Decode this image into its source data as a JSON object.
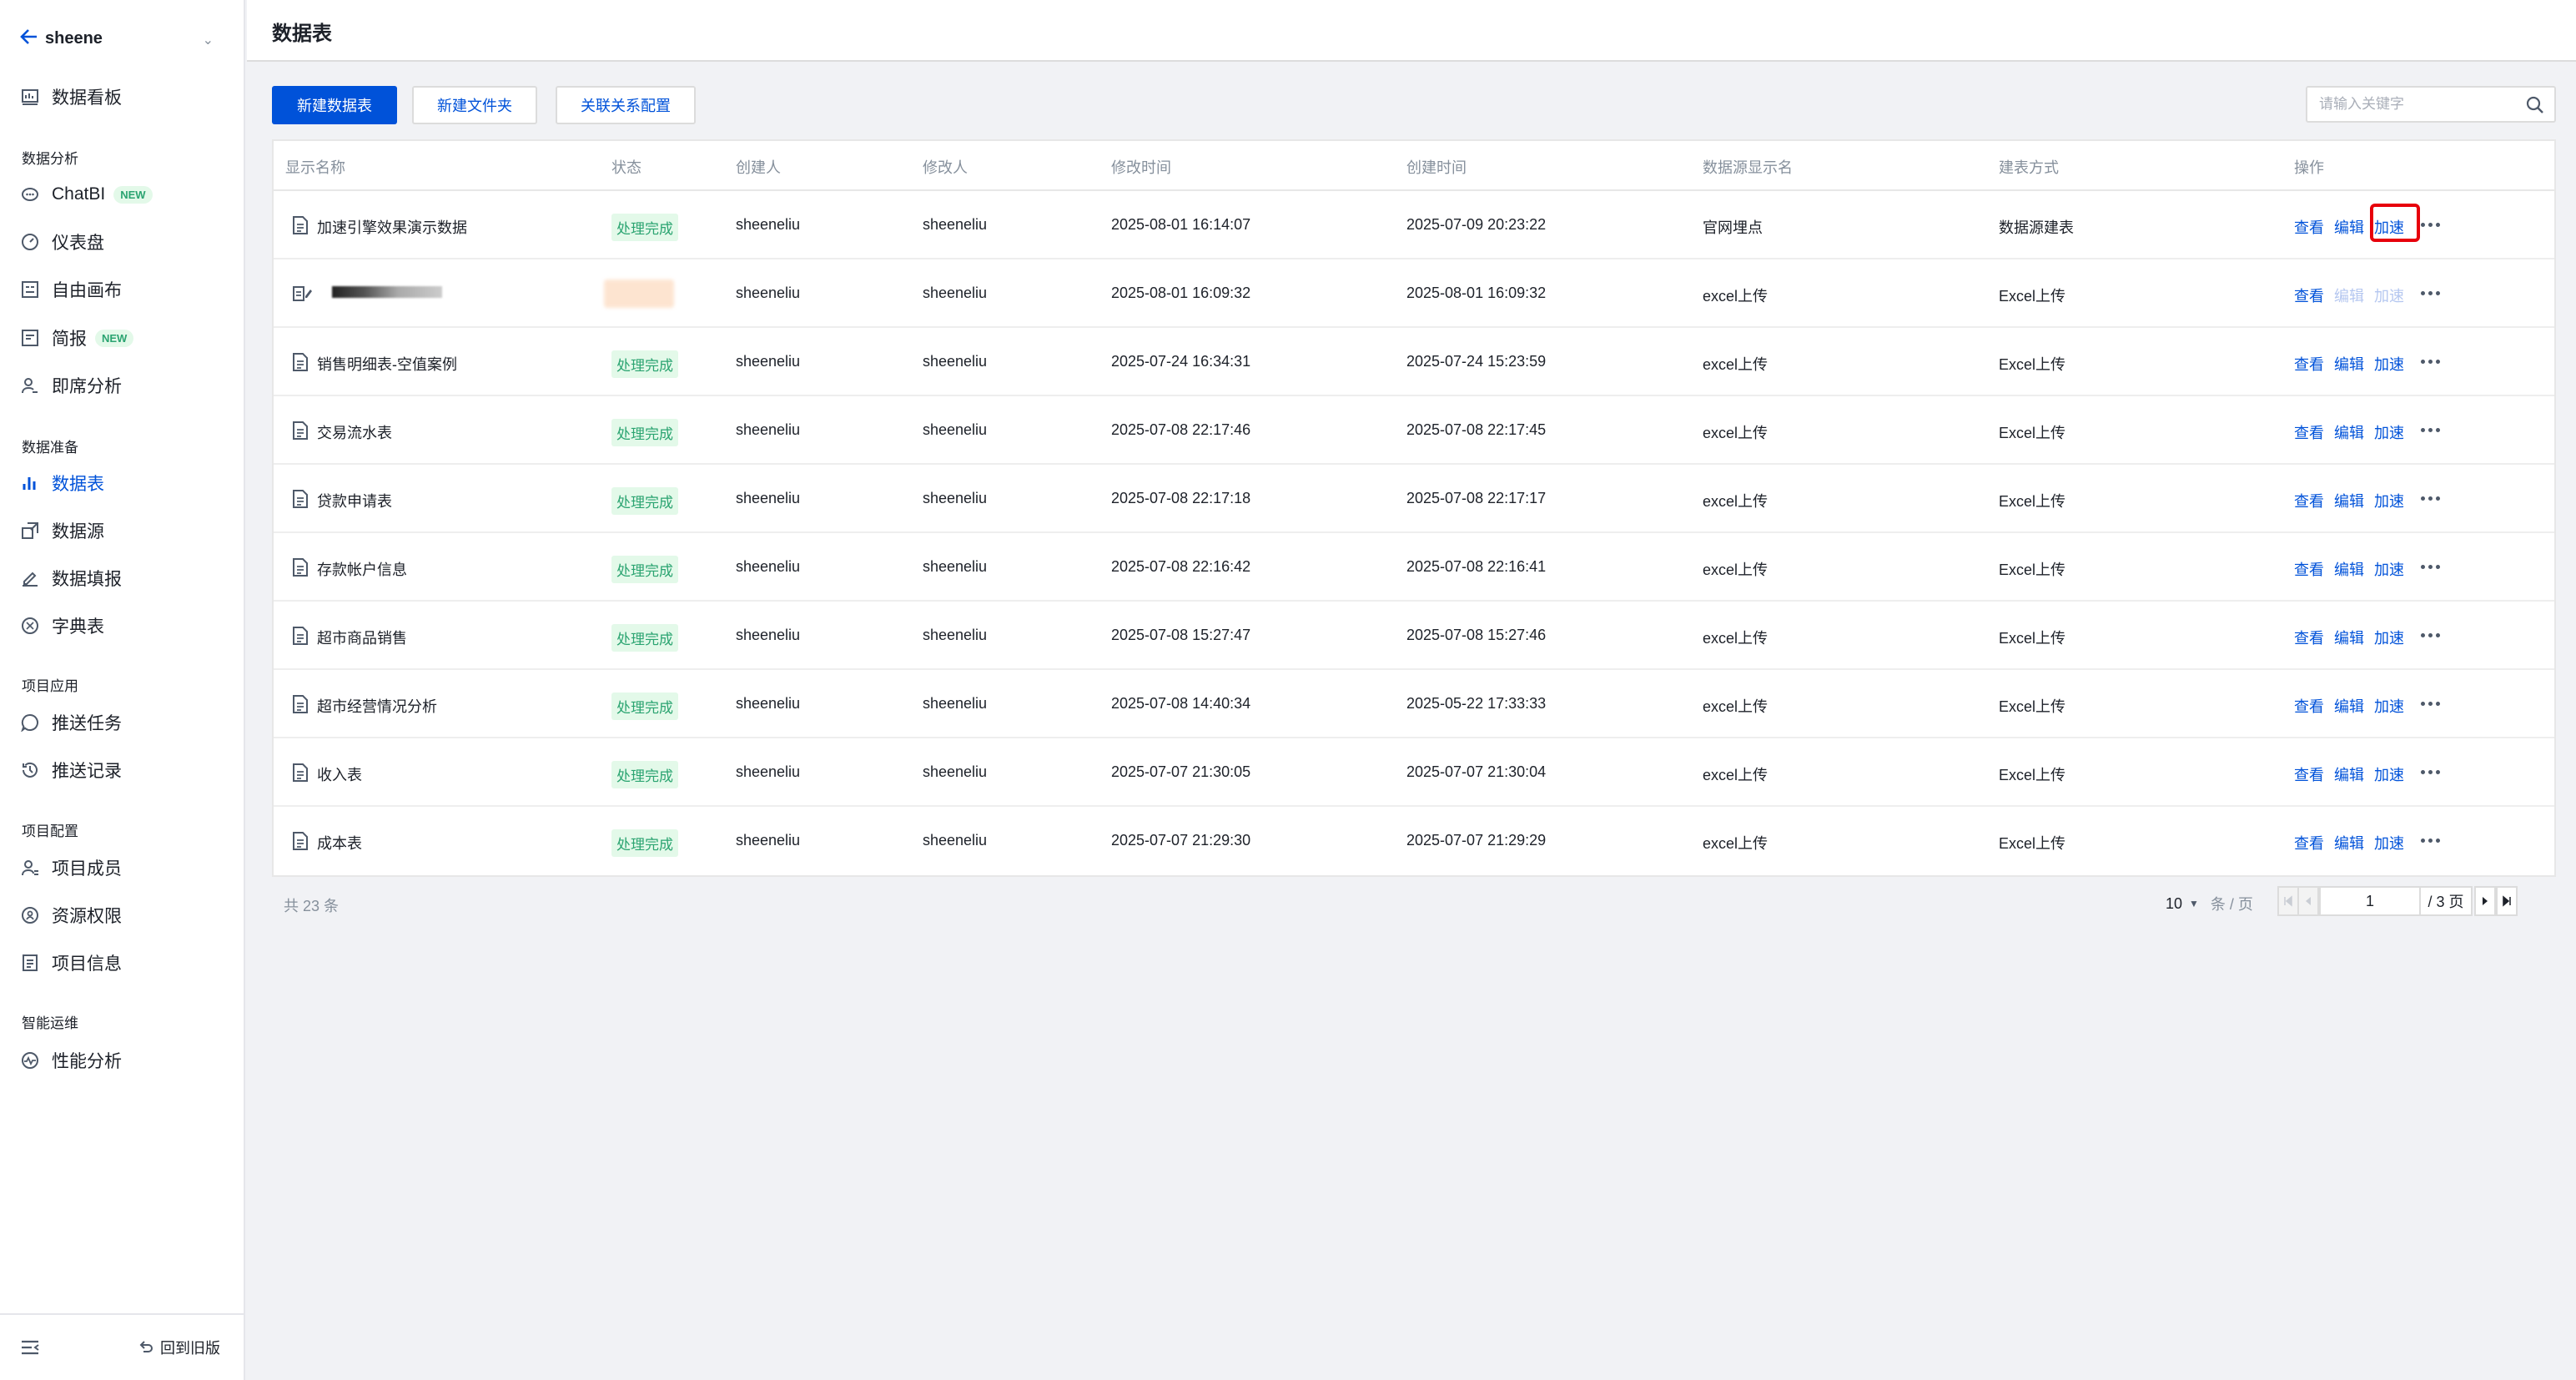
{
  "sidebar": {
    "project_name": "sheene",
    "groups": {
      "analysis": "数据分析",
      "prep": "数据准备",
      "apps": "项目应用",
      "config": "项目配置",
      "ops": "智能运维"
    },
    "items": {
      "dashboard": "数据看板",
      "chatbi": "ChatBI",
      "panel": "仪表盘",
      "canvas": "自由画布",
      "report": "简报",
      "adhoc": "即席分析",
      "datatable": "数据表",
      "datasource": "数据源",
      "datafill": "数据填报",
      "dictionary": "字典表",
      "push_task": "推送任务",
      "push_record": "推送记录",
      "members": "项目成员",
      "permissions": "资源权限",
      "project_info": "项目信息",
      "perf": "性能分析"
    },
    "badge_new": "NEW",
    "back_old": "回到旧版"
  },
  "header": {
    "title": "数据表"
  },
  "toolbar": {
    "new_table": "新建数据表",
    "new_folder": "新建文件夹",
    "relation_config": "关联关系配置",
    "search_placeholder": "请输入关键字"
  },
  "table": {
    "columns": [
      "显示名称",
      "状态",
      "创建人",
      "修改人",
      "修改时间",
      "创建时间",
      "数据源显示名",
      "建表方式",
      "操作"
    ],
    "actions": {
      "view": "查看",
      "edit": "编辑",
      "accel": "加速"
    },
    "rows": [
      {
        "name": "加速引擎效果演示数据",
        "status": "处理完成",
        "creator": "sheeneliu",
        "modifier": "sheeneliu",
        "modified": "2025-08-01 16:14:07",
        "created": "2025-07-09 20:23:22",
        "source": "官网埋点",
        "method": "数据源建表"
      },
      {
        "name": "",
        "status": "",
        "creator": "sheeneliu",
        "modifier": "sheeneliu",
        "modified": "2025-08-01 16:09:32",
        "created": "2025-08-01 16:09:32",
        "source": "excel上传",
        "method": "Excel上传"
      },
      {
        "name": "销售明细表-空值案例",
        "status": "处理完成",
        "creator": "sheeneliu",
        "modifier": "sheeneliu",
        "modified": "2025-07-24 16:34:31",
        "created": "2025-07-24 15:23:59",
        "source": "excel上传",
        "method": "Excel上传"
      },
      {
        "name": "交易流水表",
        "status": "处理完成",
        "creator": "sheeneliu",
        "modifier": "sheeneliu",
        "modified": "2025-07-08 22:17:46",
        "created": "2025-07-08 22:17:45",
        "source": "excel上传",
        "method": "Excel上传"
      },
      {
        "name": "贷款申请表",
        "status": "处理完成",
        "creator": "sheeneliu",
        "modifier": "sheeneliu",
        "modified": "2025-07-08 22:17:18",
        "created": "2025-07-08 22:17:17",
        "source": "excel上传",
        "method": "Excel上传"
      },
      {
        "name": "存款帐户信息",
        "status": "处理完成",
        "creator": "sheeneliu",
        "modifier": "sheeneliu",
        "modified": "2025-07-08 22:16:42",
        "created": "2025-07-08 22:16:41",
        "source": "excel上传",
        "method": "Excel上传"
      },
      {
        "name": "超市商品销售",
        "status": "处理完成",
        "creator": "sheeneliu",
        "modifier": "sheeneliu",
        "modified": "2025-07-08 15:27:47",
        "created": "2025-07-08 15:27:46",
        "source": "excel上传",
        "method": "Excel上传"
      },
      {
        "name": "超市经营情况分析",
        "status": "处理完成",
        "creator": "sheeneliu",
        "modifier": "sheeneliu",
        "modified": "2025-07-08 14:40:34",
        "created": "2025-05-22 17:33:33",
        "source": "excel上传",
        "method": "Excel上传"
      },
      {
        "name": "收入表",
        "status": "处理完成",
        "creator": "sheeneliu",
        "modifier": "sheeneliu",
        "modified": "2025-07-07 21:30:05",
        "created": "2025-07-07 21:30:04",
        "source": "excel上传",
        "method": "Excel上传"
      },
      {
        "name": "成本表",
        "status": "处理完成",
        "creator": "sheeneliu",
        "modifier": "sheeneliu",
        "modified": "2025-07-07 21:29:30",
        "created": "2025-07-07 21:29:29",
        "source": "excel上传",
        "method": "Excel上传"
      }
    ]
  },
  "pagination": {
    "total": "共 23 条",
    "page_size": "10",
    "per_page": "条 / 页",
    "current_page": "1",
    "total_pages": "/ 3 页"
  },
  "colors": {
    "accent": "#0052d9",
    "success": "#2ba471",
    "success_bg": "#e3f9e9",
    "highlight": "#e7000b"
  }
}
